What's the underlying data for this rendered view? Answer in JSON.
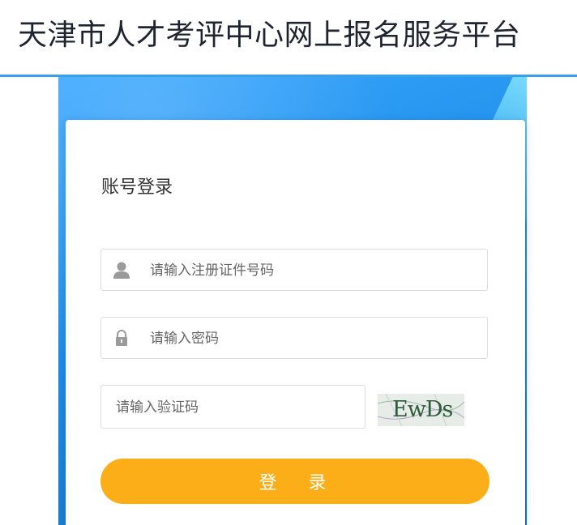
{
  "header": {
    "title": "天津市人才考评中心网上报名服务平台"
  },
  "login": {
    "title": "账号登录",
    "id_placeholder": "请输入注册证件号码",
    "password_placeholder": "请输入密码",
    "captcha_placeholder": "请输入验证码",
    "captcha_text": "EwDs",
    "submit_label": "登 录"
  },
  "icons": {
    "user": "user-icon",
    "lock": "lock-icon"
  },
  "colors": {
    "accent_line": "#3aa0e8",
    "banner": "#1e8ee8",
    "button": "#fbae17"
  }
}
